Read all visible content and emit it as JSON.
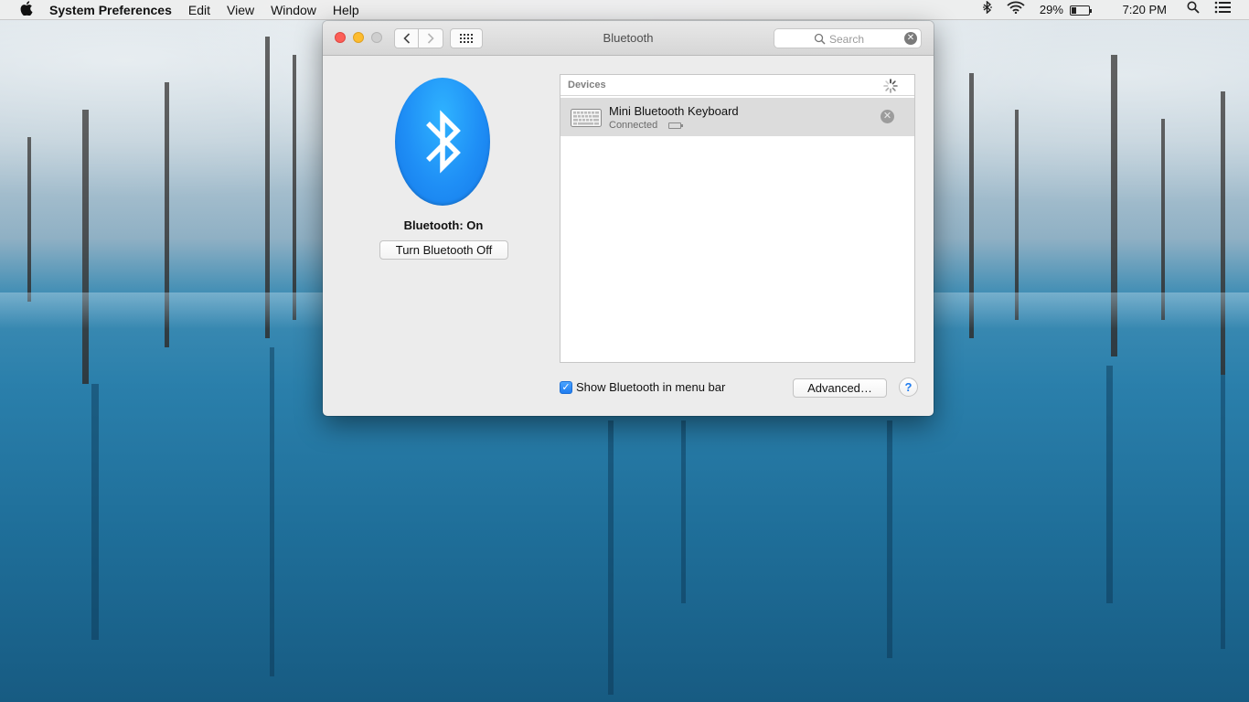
{
  "menubar": {
    "apple_icon": "apple-logo",
    "app_name": "System Preferences",
    "items": [
      "Edit",
      "View",
      "Window",
      "Help"
    ],
    "battery_percent": "29%",
    "battery_level": 0.29,
    "time": "7:20 PM"
  },
  "window": {
    "title": "Bluetooth",
    "search_placeholder": "Search"
  },
  "bluetooth": {
    "status": "Bluetooth: On",
    "toggle_label": "Turn Bluetooth Off",
    "icon_color": "#1f8ff6"
  },
  "devices": {
    "header": "Devices",
    "items": [
      {
        "name": "Mini Bluetooth Keyboard",
        "state": "Connected",
        "icon": "keyboard-icon"
      }
    ]
  },
  "footer": {
    "show_in_menu_label": "Show Bluetooth in menu bar",
    "show_in_menu_checked": true,
    "advanced_label": "Advanced…",
    "help_label": "?"
  }
}
